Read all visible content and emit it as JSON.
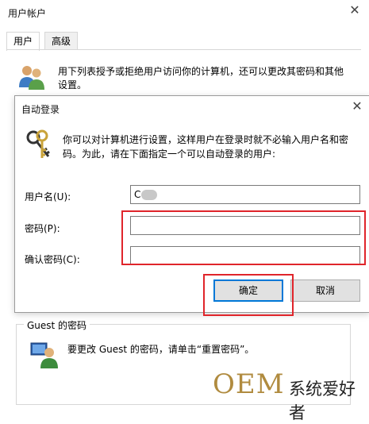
{
  "background_window": {
    "title": "用户帐户",
    "close": "✕",
    "tabs": [
      {
        "label": "用户"
      },
      {
        "label": "高级"
      }
    ],
    "description": "用下列表授予或拒绝用户访问你的计算机，还可以更改其密码和其他设置。",
    "guest": {
      "legend": "Guest 的密码",
      "text": "要更改 Guest 的密码，请单击“重置密码”。"
    }
  },
  "dialog": {
    "title": "自动登录",
    "close": "✕",
    "description": "你可以对计算机进行设置，这样用户在登录时就不必输入用户名和密码。为此，请在下面指定一个可以自动登录的用户:",
    "labels": {
      "username": "用户名(U):",
      "password": "密码(P):",
      "confirm": "确认密码(C):"
    },
    "fields": {
      "username": "C",
      "password": "",
      "confirm": ""
    },
    "buttons": {
      "ok": "确定",
      "cancel": "取消"
    }
  },
  "watermark": {
    "oem": "OEM",
    "text": "系统爱好者"
  },
  "colors": {
    "highlight": "#e0252b",
    "focus": "#0078d7",
    "watermark_gold": "#b08b3f"
  },
  "icons": {
    "users": "users-icon",
    "keys": "keys-icon",
    "guest": "guest-user-icon",
    "close": "close-icon"
  }
}
